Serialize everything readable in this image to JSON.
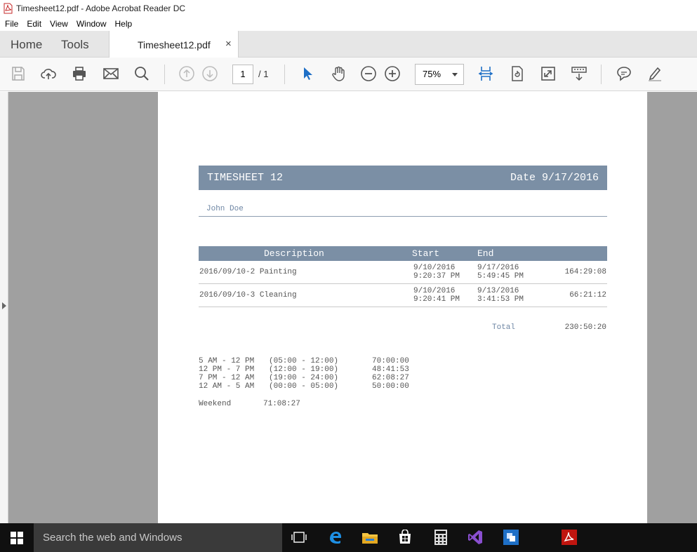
{
  "window": {
    "title": "Timesheet12.pdf - Adobe Acrobat Reader DC"
  },
  "menu": [
    "File",
    "Edit",
    "View",
    "Window",
    "Help"
  ],
  "tabs": {
    "home": "Home",
    "tools": "Tools",
    "document": "Timesheet12.pdf",
    "close": "×"
  },
  "toolbar": {
    "page_current": "1",
    "page_total": "/ 1",
    "zoom": "75%"
  },
  "document": {
    "title": "TIMESHEET 12",
    "date": "Date 9/17/2016",
    "employee": "John Doe",
    "columns": {
      "description": "Description",
      "start": "Start",
      "end": "End"
    },
    "rows": [
      {
        "description": "2016/09/10-2 Painting",
        "start_date": "9/10/2016",
        "start_time": "9:20:37 PM",
        "end_date": "9/17/2016",
        "end_time": "5:49:45 PM",
        "duration": "164:29:08"
      },
      {
        "description": "2016/09/10-3 Cleaning",
        "start_date": "9/10/2016",
        "start_time": "9:20:41 PM",
        "end_date": "9/13/2016",
        "end_time": "3:41:53 PM",
        "duration": "66:21:12"
      }
    ],
    "total_label": "Total",
    "total_value": "230:50:20",
    "shifts": [
      {
        "label": "5 AM - 12 PM",
        "range": "(05:00 - 12:00)",
        "hours": "70:00:00"
      },
      {
        "label": "12 PM - 7 PM",
        "range": "(12:00 - 19:00)",
        "hours": "48:41:53"
      },
      {
        "label": "7 PM - 12 AM",
        "range": "(19:00 - 24:00)",
        "hours": "62:08:27"
      },
      {
        "label": "12 AM - 5 AM",
        "range": "(00:00 - 05:00)",
        "hours": "50:00:00"
      }
    ],
    "weekend_label": "Weekend",
    "weekend_value": "71:08:27"
  },
  "taskbar": {
    "search_placeholder": "Search the web and Windows"
  },
  "colors": {
    "header": "#7b8fa5",
    "accent_blue": "#1e6fc6",
    "taskbar": "#101010"
  }
}
